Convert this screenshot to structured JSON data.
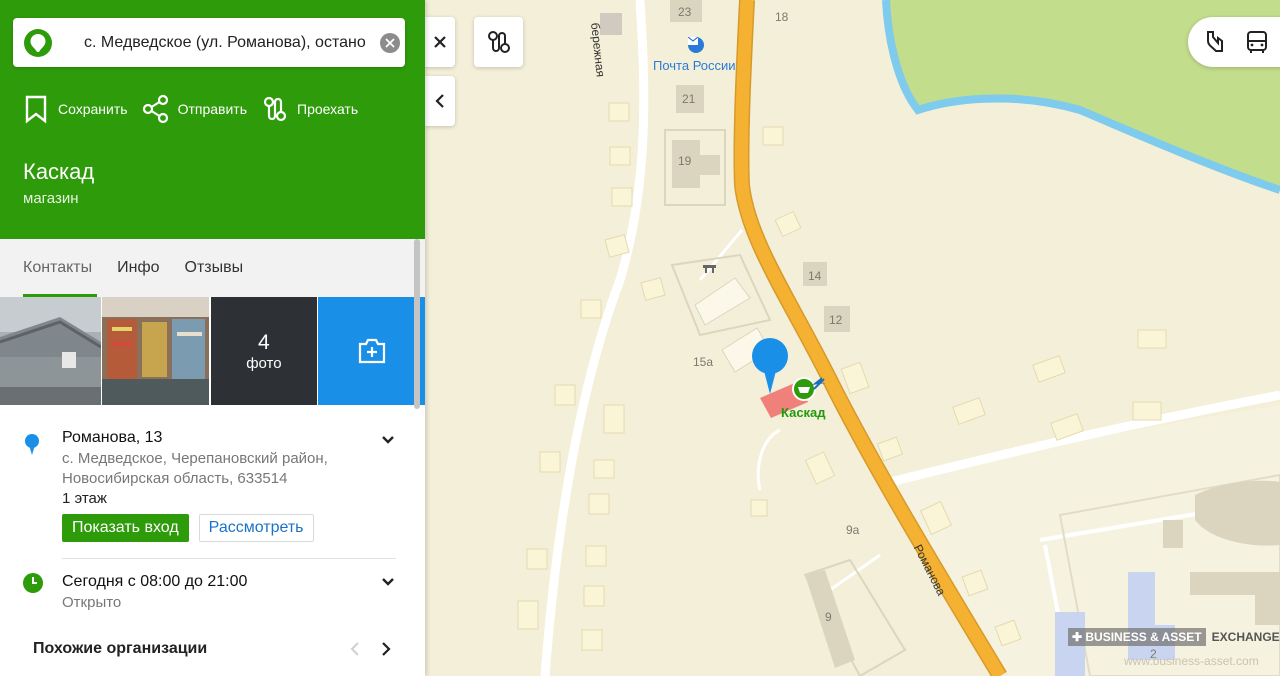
{
  "search": {
    "query": "с. Медведское (ул. Романова), остано"
  },
  "actions": {
    "save": "Сохранить",
    "share": "Отправить",
    "route": "Проехать"
  },
  "business": {
    "name": "Каскад",
    "category": "магазин"
  },
  "tabs": [
    "Контакты",
    "Инфо",
    "Отзывы"
  ],
  "photos": {
    "count": "4",
    "label": "фото"
  },
  "address": {
    "street": "Романова, 13",
    "locality": "с. Медведское, Черепановский район,",
    "region": "Новосибирская область, 633514",
    "floor": "1 этаж",
    "show_entrance": "Показать вход",
    "view": "Рассмотреть"
  },
  "hours": {
    "today": "Сегодня с 08:00 до 21:00",
    "status": "Открыто"
  },
  "similar": {
    "title": "Похожие организации"
  },
  "map": {
    "post_office": "Почта России",
    "shop_label": "Каскад",
    "street_romanova": "Романова",
    "street_naberezhnaya": "бережная",
    "houses": [
      "23",
      "18",
      "21",
      "19",
      "14",
      "12",
      "15а",
      "9а",
      "9",
      "2"
    ]
  },
  "watermark": {
    "brand": "✚ BUSINESS & ASSET",
    "exchange": "EXCHANGE",
    "url": "www.business-asset.com"
  },
  "colors": {
    "header_green": "#2e9b0a",
    "accent_blue": "#1a8fe8",
    "road_orange": "#f5b131"
  }
}
